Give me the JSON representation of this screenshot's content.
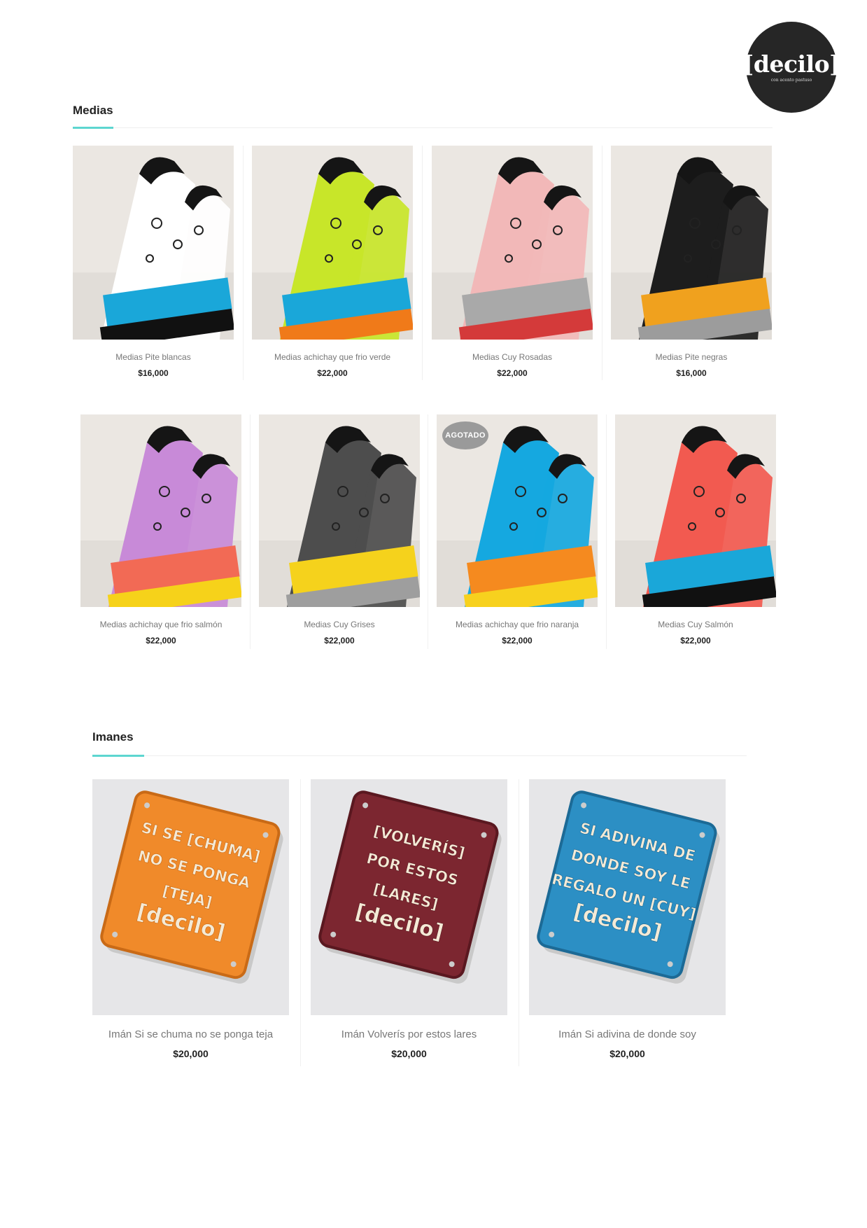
{
  "logo": {
    "brand": "[decilo]",
    "tagline": "con acento pastuso"
  },
  "sections": {
    "medias": {
      "title": "Medias",
      "products": [
        {
          "name": "Medias Pite blancas",
          "price": "$16,000",
          "colors": [
            "#ffffff",
            "#1aa7d9",
            "#111111"
          ]
        },
        {
          "name": "Medias achichay que frio verde",
          "price": "$22,000",
          "colors": [
            "#c8e629",
            "#1aa7d9",
            "#f07a19"
          ]
        },
        {
          "name": "Medias Cuy Rosadas",
          "price": "$22,000",
          "colors": [
            "#f2b8b8",
            "#a9a9a9",
            "#d43a3a"
          ]
        },
        {
          "name": "Medias Pite negras",
          "price": "$16,000",
          "colors": [
            "#1d1d1d",
            "#f0a11e",
            "#9c9c9c"
          ]
        },
        {
          "name": "Medias achichay que frio salmón",
          "price": "$22,000",
          "colors": [
            "#c88ad8",
            "#f26a55",
            "#f6d21a"
          ]
        },
        {
          "name": "Medias Cuy Grises",
          "price": "$22,000",
          "colors": [
            "#4d4d4d",
            "#f5d21c",
            "#9e9e9e"
          ]
        },
        {
          "name": "Medias achichay que frio naranja",
          "price": "$22,000",
          "colors": [
            "#15a8e0",
            "#f58a1f",
            "#f7d11e"
          ],
          "badge": "AGOTADO"
        },
        {
          "name": "Medias Cuy Salmón",
          "price": "$22,000",
          "colors": [
            "#f25a50",
            "#1aa7d9",
            "#111111"
          ]
        }
      ]
    },
    "imanes": {
      "title": "Imanes",
      "products": [
        {
          "name": "Imán Si se chuma no se ponga teja",
          "price": "$20,000",
          "colors": [
            "#f08a2a",
            "#c96a16"
          ],
          "text": [
            "SI SE [CHUMA]",
            "NO SE PONGA",
            "[TEJA]",
            "[decilo]"
          ]
        },
        {
          "name": "Imán Volverís por estos lares",
          "price": "$20,000",
          "colors": [
            "#7c2630",
            "#5a1820"
          ],
          "text": [
            "[VOLVERÍS]",
            "POR ESTOS",
            "[LARES]",
            "[decilo]"
          ]
        },
        {
          "name": "Imán Si adivina de donde soy",
          "price": "$20,000",
          "colors": [
            "#2c8fc4",
            "#1c6a96"
          ],
          "text": [
            "SI ADIVINA DE",
            "DONDE SOY LE",
            "REGALO UN [CUY]",
            "[decilo]"
          ]
        }
      ]
    }
  }
}
